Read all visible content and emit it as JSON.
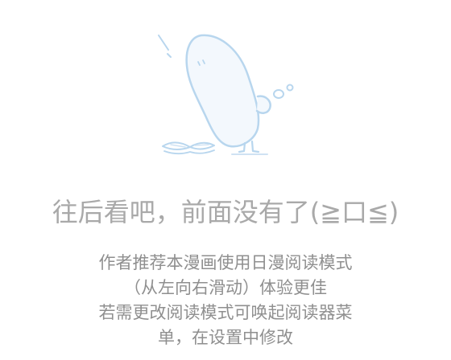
{
  "empty_state": {
    "illustration_icon": "bean-character-reading-book-icon",
    "headline": "往后看吧，前面没有了(≧口≦)",
    "notice_lines": [
      "作者推荐本漫画使用日漫阅读模式",
      "（从左向右滑动）体验更佳",
      "若需更改阅读模式可唤起阅读器菜",
      "单，在设置中修改"
    ]
  },
  "colors": {
    "background": "#ffffff",
    "illustration_fill": "#f3f8fd",
    "illustration_stroke": "#b8d6ee",
    "headline_text": "#a9a9a9",
    "notice_text": "#8f8f8f"
  }
}
